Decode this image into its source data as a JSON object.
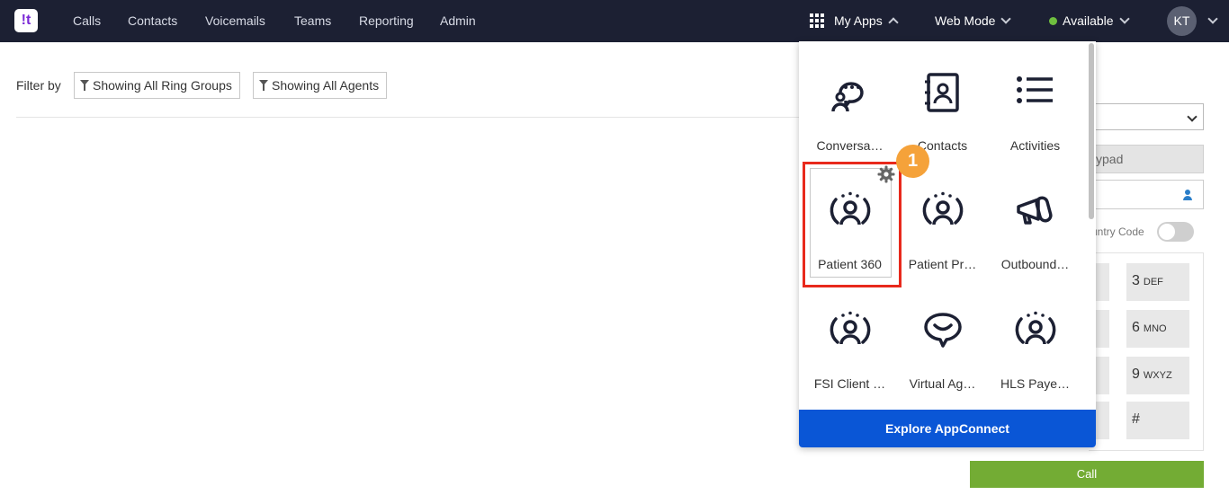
{
  "nav": {
    "logo": "!t",
    "items": [
      "Calls",
      "Contacts",
      "Voicemails",
      "Teams",
      "Reporting",
      "Admin"
    ],
    "my_apps": "My Apps",
    "web_mode": "Web Mode",
    "status": "Available",
    "avatar_initials": "KT"
  },
  "filters": {
    "label": "Filter by",
    "ring_groups": "Showing All Ring Groups",
    "agents": "Showing All Agents"
  },
  "dialer": {
    "keypad_tab": "ypad",
    "country_code_label": "untry Code",
    "keys": [
      {
        "digit": "3",
        "letters": "DEF"
      },
      {
        "digit": "6",
        "letters": "MNO"
      },
      {
        "digit": "9",
        "letters": "WXYZ"
      },
      {
        "digit": "#",
        "letters": ""
      }
    ],
    "call": "Call"
  },
  "apps": {
    "tiles": [
      {
        "label": "Conversa…",
        "icon": "conversation-icon"
      },
      {
        "label": "Contacts",
        "icon": "contacts-book-icon"
      },
      {
        "label": "Activities",
        "icon": "list-icon"
      },
      {
        "label": "Patient 360",
        "icon": "person-broadcast-icon"
      },
      {
        "label": "Patient Pr…",
        "icon": "person-broadcast-icon"
      },
      {
        "label": "Outbound…",
        "icon": "megaphone-icon"
      },
      {
        "label": "FSI Client …",
        "icon": "person-broadcast-icon"
      },
      {
        "label": "Virtual Ag…",
        "icon": "chat-smile-icon"
      },
      {
        "label": "HLS Paye…",
        "icon": "person-broadcast-icon"
      }
    ],
    "step_badge": "1",
    "explore": "Explore AppConnect"
  }
}
